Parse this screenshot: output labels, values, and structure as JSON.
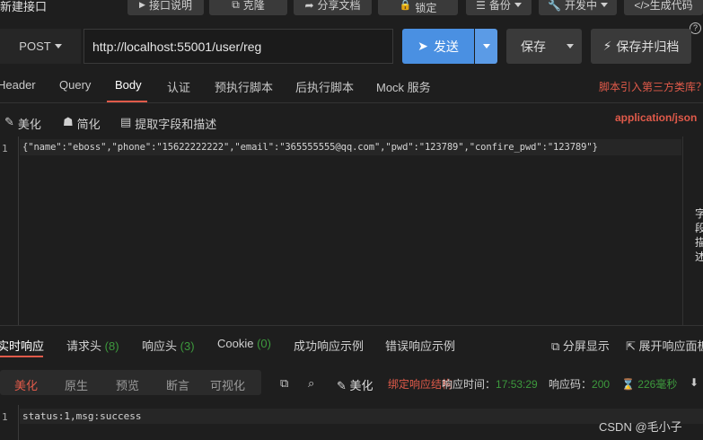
{
  "window": {
    "title": "新建接口",
    "help": "?"
  },
  "toolbar": {
    "doc": "接口说明",
    "clone": "克隆",
    "share": "分享文档",
    "lock": "锁定",
    "backup": "备份",
    "dev": "开发中",
    "codegen": "</>生成代码"
  },
  "request": {
    "method": "POST",
    "url": "http://localhost:55001/user/reg",
    "send": "发送",
    "save": "保存",
    "save_archive": "保存并归档"
  },
  "tabs": {
    "header": "Header",
    "query": "Query",
    "body": "Body",
    "auth": "认证",
    "pre": "预执行脚本",
    "post": "后执行脚本",
    "mock": "Mock 服务",
    "third_party": "脚本引入第三方类库？"
  },
  "body_toolbar": {
    "beautify": "美化",
    "simplify": "简化",
    "extract": "提取字段和描述",
    "content_type": "application/json"
  },
  "editor": {
    "line": "1",
    "code": "{\"name\":\"eboss\",\"phone\":\"15622222222\",\"email\":\"365555555@qq.com\",\"pwd\":\"123789\",\"confire_pwd\":\"123789\"}",
    "side_label": "字段描述"
  },
  "response": {
    "tabs": {
      "realtime": "实时响应",
      "req_headers": "请求头",
      "req_headers_count": "(8)",
      "resp_headers": "响应头",
      "resp_headers_count": "(3)",
      "cookie": "Cookie",
      "cookie_count": "(0)",
      "success_example": "成功响应示例",
      "error_example": "错误响应示例"
    },
    "split": "分屏显示",
    "expand": "展开响应面板",
    "views": {
      "beautify": "美化",
      "raw": "原生",
      "preview": "预览",
      "assert": "断言",
      "visual": "可视化"
    },
    "beautify2": "美化",
    "bind_hint": "绑定响应结构",
    "time_label": "响应时间：",
    "time_value": "17:53:29",
    "code_label": "响应码：",
    "code_value": "200",
    "duration": "226毫秒",
    "line": "1",
    "body": "status:1,msg:success"
  },
  "watermark": "CSDN @毛小子",
  "colors": {
    "accent": "#e05a4a",
    "send_blue": "#4a90e2",
    "success_green": "#3d9a3d"
  }
}
